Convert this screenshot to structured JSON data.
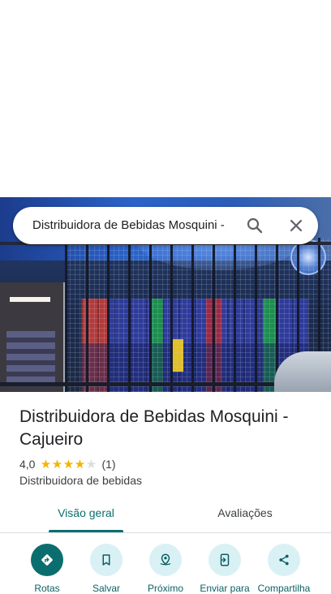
{
  "search": {
    "query": "Distribuidora de Bebidas Mosquini -",
    "search_icon": "search-icon",
    "clear_icon": "close-icon"
  },
  "place": {
    "name": "Distribuidora de Bebidas Mosquini - Cajueiro",
    "rating": "4,0",
    "rating_value": 4,
    "stars": [
      "★",
      "★",
      "★",
      "★",
      "★"
    ],
    "review_count": "(1)",
    "category": "Distribuidora de bebidas"
  },
  "tabs": [
    {
      "label": "Visão geral",
      "active": true
    },
    {
      "label": "Avaliações",
      "active": false
    }
  ],
  "actions": [
    {
      "label": "Rotas",
      "icon": "directions-icon"
    },
    {
      "label": "Salvar",
      "icon": "bookmark-icon"
    },
    {
      "label": "Próximo",
      "icon": "nearby-icon"
    },
    {
      "label": "Enviar para",
      "icon": "send-to-phone-icon"
    },
    {
      "label": "Compartilha",
      "icon": "share-icon"
    }
  ],
  "colors": {
    "accent": "#0b6e6e",
    "accent_light": "#d9f1f4",
    "star_filled": "#f4b400",
    "star_empty": "#dadce0"
  }
}
